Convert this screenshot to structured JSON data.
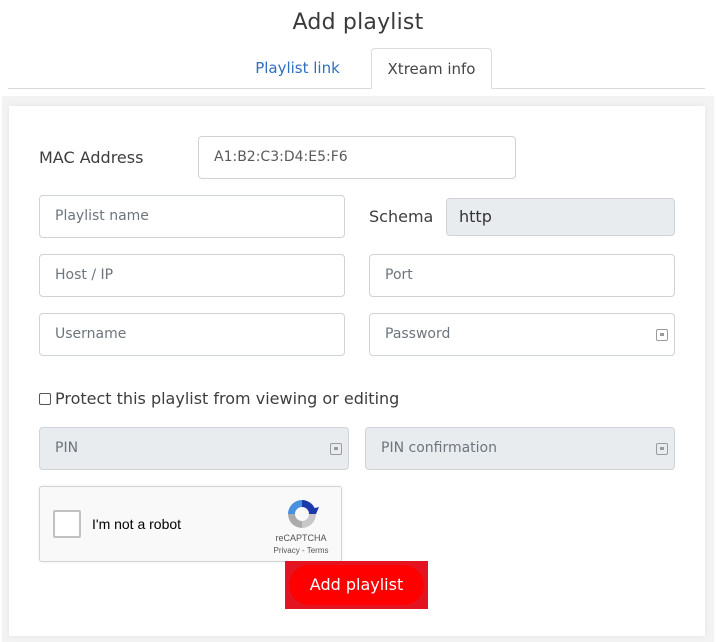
{
  "page": {
    "title": "Add playlist"
  },
  "tabs": [
    {
      "label": "Playlist link",
      "active": false
    },
    {
      "label": "Xtream info",
      "active": true
    }
  ],
  "form": {
    "mac_label": "MAC Address",
    "mac_value": "A1:B2:C3:D4:E5:F6",
    "playlist_name_placeholder": "Playlist name",
    "schema_label": "Schema",
    "schema_value": "http",
    "host_placeholder": "Host / IP",
    "port_placeholder": "Port",
    "username_placeholder": "Username",
    "password_placeholder": "Password",
    "protect_label": "Protect this playlist from viewing or editing",
    "protect_checked": false,
    "pin_placeholder": "PIN",
    "pin_confirm_placeholder": "PIN confirmation"
  },
  "recaptcha": {
    "label": "I'm not a robot",
    "brand": "reCAPTCHA",
    "links": "Privacy - Terms"
  },
  "submit": {
    "label": "Add playlist"
  },
  "colors": {
    "tab_link": "#2f6fbf",
    "button_bg": "#ff0000",
    "button_frame": "#e3141f",
    "disabled_bg": "#e9ecef"
  }
}
